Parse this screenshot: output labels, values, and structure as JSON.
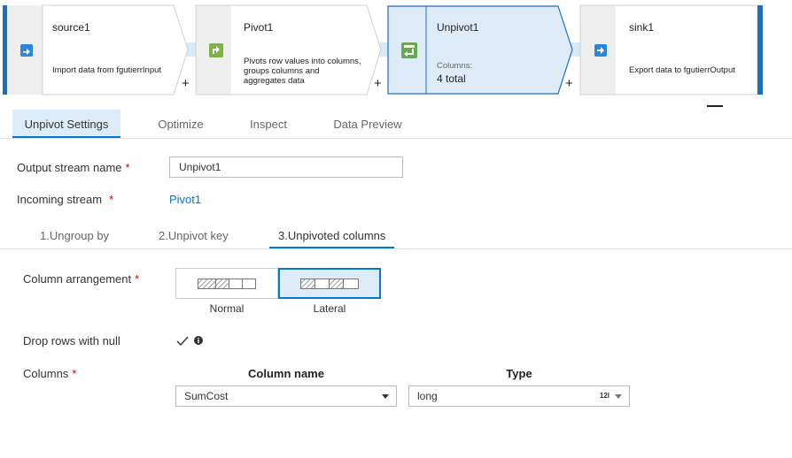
{
  "pipeline": {
    "nodes": [
      {
        "title": "source1",
        "description": "Import data from fgutierrInput",
        "icon": "source-icon"
      },
      {
        "title": "Pivot1",
        "description": "Pivots row values into columns, groups columns and aggregates data",
        "description_lines": [
          "Pivots row values into columns,",
          "groups columns and",
          "aggregates data"
        ],
        "icon": "pivot-icon"
      },
      {
        "title": "Unpivot1",
        "columns_label": "Columns:",
        "columns_value": "4 total",
        "icon": "unpivot-icon"
      },
      {
        "title": "sink1",
        "description": "Export data to fgutierrOutput",
        "icon": "sink-icon"
      }
    ],
    "add_label": "+"
  },
  "tabs": [
    {
      "label": "Unpivot Settings",
      "active": true
    },
    {
      "label": "Optimize",
      "active": false
    },
    {
      "label": "Inspect",
      "active": false
    },
    {
      "label": "Data Preview",
      "active": false
    }
  ],
  "settings": {
    "output_stream_label": "Output stream name",
    "output_stream_value": "Unpivot1",
    "incoming_stream_label": "Incoming stream",
    "incoming_stream_value": "Pivot1",
    "required_marker": "*"
  },
  "subtabs": [
    {
      "label": "1.Ungroup by",
      "active": false
    },
    {
      "label": "2.Unpivot key",
      "active": false
    },
    {
      "label": "3.Unpivoted columns",
      "active": true
    }
  ],
  "unpivoted": {
    "arrangement_label": "Column arrangement",
    "arrangement_options": [
      {
        "label": "Normal",
        "selected": false
      },
      {
        "label": "Lateral",
        "selected": true
      }
    ],
    "drop_rows_label": "Drop rows with null",
    "drop_rows_checked": true,
    "columns_label": "Columns",
    "column_name_header": "Column name",
    "type_header": "Type",
    "column_name_value": "SumCost",
    "type_value": "long",
    "type_badge": "12l"
  },
  "colors": {
    "accent": "#0078d4",
    "selected_bg": "#deecf9",
    "node_edge": "#1f6fbf",
    "required": "#cc0000"
  }
}
